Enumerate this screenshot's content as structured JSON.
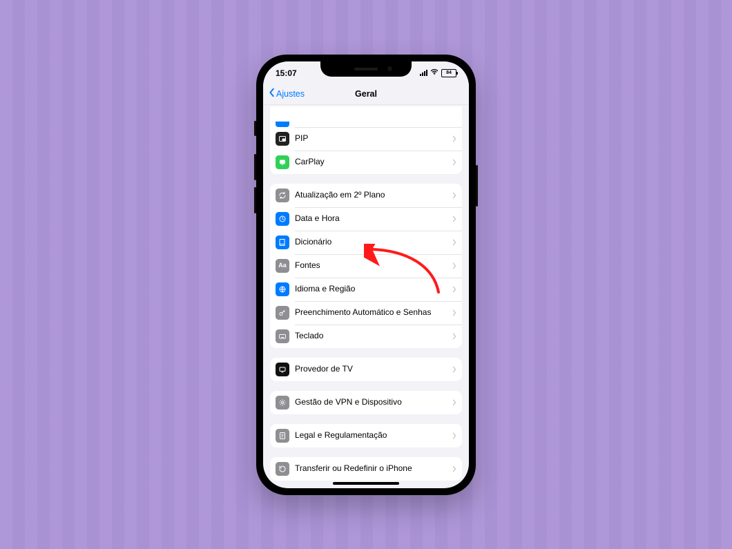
{
  "status": {
    "time": "15:07",
    "battery_level": "84"
  },
  "nav": {
    "back_label": "Ajustes",
    "title": "Geral"
  },
  "groups": [
    {
      "first_peek_color": "#007aff",
      "rows": [
        {
          "icon": "pip",
          "color": "#222222",
          "label": "PIP"
        },
        {
          "icon": "carplay",
          "color": "#30d158",
          "label": "CarPlay"
        }
      ]
    },
    {
      "rows": [
        {
          "icon": "refresh",
          "color": "#8e8e93",
          "label": "Atualização em 2º Plano"
        },
        {
          "icon": "clock",
          "color": "#007aff",
          "label": "Data e Hora"
        },
        {
          "icon": "book",
          "color": "#007aff",
          "label": "Dicionário"
        },
        {
          "icon": "fonts",
          "color": "#8e8e93",
          "label": "Fontes"
        },
        {
          "icon": "globe",
          "color": "#007aff",
          "label": "Idioma e Região"
        },
        {
          "icon": "key",
          "color": "#8e8e93",
          "label": "Preenchimento Automático e Senhas"
        },
        {
          "icon": "keyboard",
          "color": "#8e8e93",
          "label": "Teclado"
        }
      ]
    },
    {
      "rows": [
        {
          "icon": "tv",
          "color": "#111111",
          "label": "Provedor de TV"
        }
      ]
    },
    {
      "rows": [
        {
          "icon": "vpn",
          "color": "#8e8e93",
          "label": "Gestão de VPN e Dispositivo"
        }
      ]
    },
    {
      "rows": [
        {
          "icon": "legal",
          "color": "#8e8e93",
          "label": "Legal e Regulamentação"
        }
      ]
    },
    {
      "rows": [
        {
          "icon": "reset",
          "color": "#8e8e93",
          "label": "Transferir ou Redefinir o iPhone"
        }
      ]
    }
  ]
}
